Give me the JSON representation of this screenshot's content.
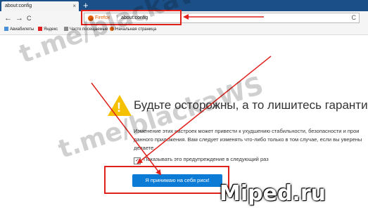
{
  "tab": {
    "title": "about:config",
    "close": "×"
  },
  "new_tab": "+",
  "nav": {
    "back": "←",
    "forward": "→",
    "reload": "C"
  },
  "urlbar": {
    "identity": "Firefox",
    "url": "about:config",
    "reload": "C"
  },
  "bookmarks": [
    {
      "label": "Авиабилеты"
    },
    {
      "label": "Яндекс"
    },
    {
      "label": "Часто посещаемые"
    },
    {
      "label": "Начальная страница"
    }
  ],
  "warning": {
    "headline": "Будьте осторожны, а то лишитесь гаранти",
    "description": "Изменение этих настроек может привести к ухудшению стабильности, безопасности и прои данного приложения. Вам следует изменять что-либо только в том случае, если вы уверены делаете.",
    "checkbox_label": "Показывать это предупреждение в следующий раз",
    "checkbox_checked": true,
    "accept_button": "Я принимаю на себя риск!"
  },
  "watermarks": {
    "telegram": "t.me/blackaWS",
    "site": "Miped.ru"
  },
  "colors": {
    "annotation_red": "#e0201b",
    "accent_blue": "#0c7bd6",
    "tab_bar": "#1b4f87"
  }
}
